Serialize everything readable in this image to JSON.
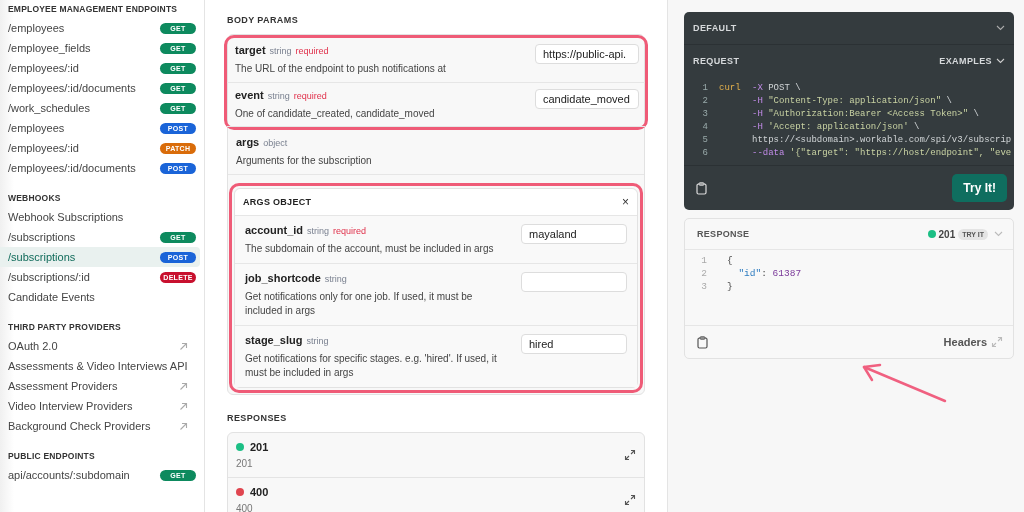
{
  "sidebar": {
    "sections": [
      {
        "title": "EMPLOYEE MANAGEMENT ENDPOINTS",
        "items": [
          {
            "label": "/employees",
            "selected": false,
            "badge": {
              "text": "GET",
              "color": "#0d8a5e"
            }
          },
          {
            "label": "/employee_fields",
            "selected": false,
            "badge": {
              "text": "GET",
              "color": "#0d8a5e"
            }
          },
          {
            "label": "/employees/:id",
            "selected": false,
            "badge": {
              "text": "GET",
              "color": "#0d8a5e"
            }
          },
          {
            "label": "/employees/:id/documents",
            "selected": false,
            "badge": {
              "text": "GET",
              "color": "#0d8a5e"
            }
          },
          {
            "label": "/work_schedules",
            "selected": false,
            "badge": {
              "text": "GET",
              "color": "#0d8a5e"
            }
          },
          {
            "label": "/employees",
            "selected": false,
            "badge": {
              "text": "POST",
              "color": "#1a64d8"
            }
          },
          {
            "label": "/employees/:id",
            "selected": false,
            "badge": {
              "text": "PATCH",
              "color": "#d96c0a"
            }
          },
          {
            "label": "/employees/:id/documents",
            "selected": false,
            "badge": {
              "text": "POST",
              "color": "#1a64d8"
            }
          }
        ]
      },
      {
        "title": "WEBHOOKS",
        "items": [
          {
            "label": "Webhook Subscriptions",
            "selected": false
          },
          {
            "label": "/subscriptions",
            "selected": false,
            "badge": {
              "text": "GET",
              "color": "#0d8a5e"
            }
          },
          {
            "label": "/subscriptions",
            "selected": true,
            "badge": {
              "text": "POST",
              "color": "#1a64d8"
            }
          },
          {
            "label": "/subscriptions/:id",
            "selected": false,
            "badge": {
              "text": "DELETE",
              "color": "#c8102e"
            }
          },
          {
            "label": "Candidate Events",
            "selected": false
          }
        ]
      },
      {
        "title": "THIRD PARTY PROVIDERS",
        "items": [
          {
            "label": "OAuth 2.0",
            "selected": false,
            "external": true
          },
          {
            "label": "Assessments & Video Interviews API",
            "selected": false,
            "external": false
          },
          {
            "label": "Assessment Providers",
            "selected": false,
            "external": true
          },
          {
            "label": "Video Interview Providers",
            "selected": false,
            "external": true
          },
          {
            "label": "Background Check Providers",
            "selected": false,
            "external": true
          }
        ]
      },
      {
        "title": "PUBLIC ENDPOINTS",
        "items": [
          {
            "label": "api/accounts/:subdomain",
            "selected": false,
            "badge": {
              "text": "GET",
              "color": "#0d8a5e"
            }
          }
        ]
      }
    ]
  },
  "body_params": {
    "title": "BODY PARAMS",
    "groups": [
      {
        "highlighted": true,
        "params": [
          {
            "kind": "field",
            "name": "target",
            "type": "string",
            "required": "required",
            "description": "The URL of the endpoint to push notifications at",
            "value": "https://public-api."
          },
          {
            "kind": "field",
            "name": "event",
            "type": "string",
            "required": "required",
            "description": "One of candidate_created, candidate_moved",
            "value": "candidate_moved"
          }
        ]
      },
      {
        "highlighted": false,
        "params": [
          {
            "kind": "object",
            "name": "args",
            "type": "object",
            "description": "Arguments for the subscription",
            "object": {
              "title": "ARGS OBJECT",
              "close": "×",
              "highlighted": true,
              "params": [
                {
                  "kind": "field",
                  "name": "account_id",
                  "type": "string",
                  "required": "required",
                  "description": "The subdomain of the account, must be included in args",
                  "value": "mayaland"
                },
                {
                  "kind": "field",
                  "name": "job_shortcode",
                  "type": "string",
                  "description": "Get notifications only for one job. If used, it must be included in args"
                },
                {
                  "kind": "field",
                  "name": "stage_slug",
                  "type": "string",
                  "description": "Get notifications for specific stages. e.g. 'hired'. If used, it must be included in args",
                  "value": "hired"
                }
              ]
            }
          }
        ]
      }
    ]
  },
  "responses": {
    "title": "RESPONSES",
    "items": [
      {
        "code": "201",
        "description": "201",
        "color": "#1cbf85"
      },
      {
        "code": "400",
        "description": "400",
        "color": "#e0454f"
      }
    ]
  },
  "request": {
    "selector": "DEFAULT",
    "title": "REQUEST",
    "examples": "EXAMPLES",
    "try_button": "Try It!",
    "lines": [
      {
        "number": "1",
        "indent": false,
        "tokens": [
          {
            "kind": "command",
            "t": "curl"
          },
          {
            "kind": "flag",
            "t": "-X"
          },
          {
            "kind": "plain",
            "t": " POST \\"
          }
        ]
      },
      {
        "number": "2",
        "indent": true,
        "tokens": [
          {
            "kind": "flag",
            "t": "-H"
          },
          {
            "kind": "string",
            "t": " \"Content-Type: application/json\""
          },
          {
            "kind": "plain",
            "t": " \\"
          }
        ]
      },
      {
        "number": "3",
        "indent": true,
        "tokens": [
          {
            "kind": "flag",
            "t": "-H"
          },
          {
            "kind": "string",
            "t": " \"Authorization:Bearer <Access Token>\""
          },
          {
            "kind": "plain",
            "t": " \\"
          }
        ]
      },
      {
        "number": "4",
        "indent": true,
        "tokens": [
          {
            "kind": "flag",
            "t": "-H"
          },
          {
            "kind": "string",
            "t": " 'Accept: application/json'"
          },
          {
            "kind": "plain",
            "t": " \\"
          }
        ]
      },
      {
        "number": "5",
        "indent": true,
        "tokens": [
          {
            "kind": "plain",
            "t": "https://<subdomain>.workable.com/spi/v3/subscrip"
          }
        ]
      },
      {
        "number": "6",
        "indent": true,
        "tokens": [
          {
            "kind": "flag",
            "t": "--data"
          },
          {
            "kind": "string",
            "t": " '{\"target\": \"https://host/endpoint\", \"eve"
          }
        ]
      }
    ]
  },
  "response": {
    "title": "RESPONSE",
    "status": {
      "code": "201",
      "color": "#1cbf85"
    },
    "badge": "TRY IT",
    "footer_link": "Headers",
    "lines": [
      {
        "number": "1",
        "indent": false,
        "tokens": [
          {
            "kind": "punct",
            "t": "{"
          }
        ]
      },
      {
        "number": "2",
        "indent": true,
        "tokens": [
          {
            "kind": "key",
            "t": "\"id\""
          },
          {
            "kind": "punct",
            "t": ": "
          },
          {
            "kind": "number",
            "t": "61387"
          }
        ]
      },
      {
        "number": "3",
        "indent": false,
        "tokens": [
          {
            "kind": "punct",
            "t": "}"
          }
        ]
      }
    ]
  }
}
